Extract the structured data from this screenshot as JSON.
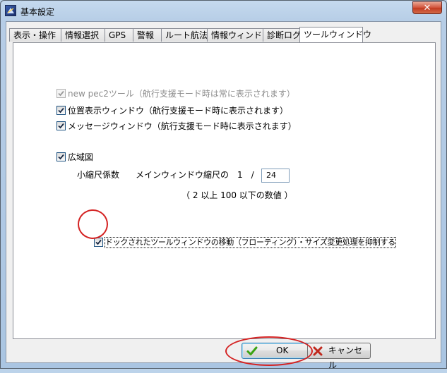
{
  "window": {
    "title": "基本設定",
    "close_label": "✕"
  },
  "tabs": [
    "表示・操作",
    "情報選択",
    "GPS",
    "警報",
    "ルート航法",
    "情報ウィンドウ",
    "診断ログ",
    "ツールウィンドウ"
  ],
  "active_tab": 7,
  "options": {
    "new_pec2": {
      "label": "new pec2ツール（航行支援モード時は常に表示されます）",
      "checked": true,
      "disabled": true
    },
    "position_window": {
      "label": "位置表示ウィンドウ（航行支援モード時に表示されます）",
      "checked": true
    },
    "message_window": {
      "label": "メッセージウィンドウ（航行支援モード時に表示されます）",
      "checked": true
    },
    "wide_map": {
      "label": "広域図",
      "checked": true
    },
    "scale_label": "小縮尺係数",
    "scale_desc": "メインウィンドウ縮尺の　1　/",
    "scale_value": "24",
    "scale_hint": "（ 2 以上  100 以下の数値 ）",
    "dock_lock": {
      "label": "ドックされたツールウィンドウの移動（フローティング）・サイズ変更処理を抑制する",
      "checked": true
    }
  },
  "buttons": {
    "ok": "OK",
    "cancel": "キャンセル"
  },
  "colors": {
    "annotation": "#d42222",
    "ok_check": "#3aa312",
    "cancel_x": "#c0281c"
  }
}
